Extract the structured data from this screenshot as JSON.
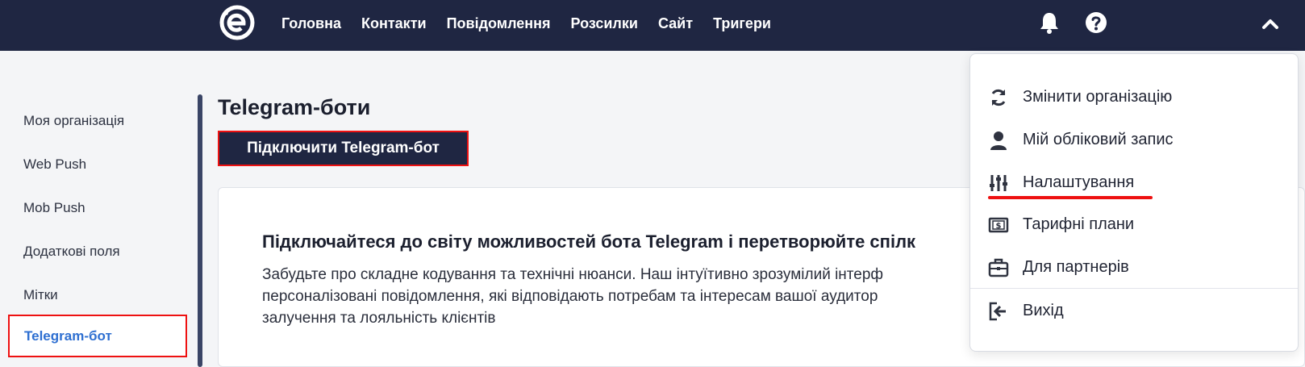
{
  "nav": {
    "items": [
      "Головна",
      "Контакти",
      "Повідомлення",
      "Розсилки",
      "Сайт",
      "Тригери"
    ]
  },
  "icons": {
    "logo": "brand-logo-icon",
    "bell": "bell-icon",
    "help": "help-circle-icon",
    "chevron": "chevron-up-icon"
  },
  "sidebar": {
    "items": [
      {
        "label": "Моя організація"
      },
      {
        "label": "Web Push"
      },
      {
        "label": "Mob Push"
      },
      {
        "label": "Додаткові поля"
      },
      {
        "label": "Мітки"
      },
      {
        "label": "Telegram-бот"
      }
    ],
    "active": "Telegram-бот"
  },
  "main": {
    "title": "Telegram-боти",
    "connect_button": "Підключити Telegram-бот",
    "card": {
      "heading": "Підключайтеся до світу можливостей бота Telegram і перетворюйте спілк",
      "body_lines": [
        "Забудьте про складне кодування та технічні нюанси. Наш інтуїтивно зрозумілий інтерф",
        "персоналізовані повідомлення, які відповідають потребам та інтересам вашої аудитор",
        "залучення та лояльність клієнтів"
      ]
    }
  },
  "dropdown": {
    "items": [
      {
        "label": "Змінити організацію",
        "icon": "refresh-icon"
      },
      {
        "label": "Мій обліковий запис",
        "icon": "user-icon"
      },
      {
        "label": "Налаштування",
        "icon": "sliders-icon"
      },
      {
        "label": "Тарифні плани",
        "icon": "money-icon"
      },
      {
        "label": "Для партнерів",
        "icon": "briefcase-icon"
      },
      {
        "label": "Вихід",
        "icon": "logout-icon"
      }
    ]
  },
  "colors": {
    "topbar": "#1f2642",
    "accent_red": "#ee1111",
    "active_link": "#2e6fd1"
  }
}
